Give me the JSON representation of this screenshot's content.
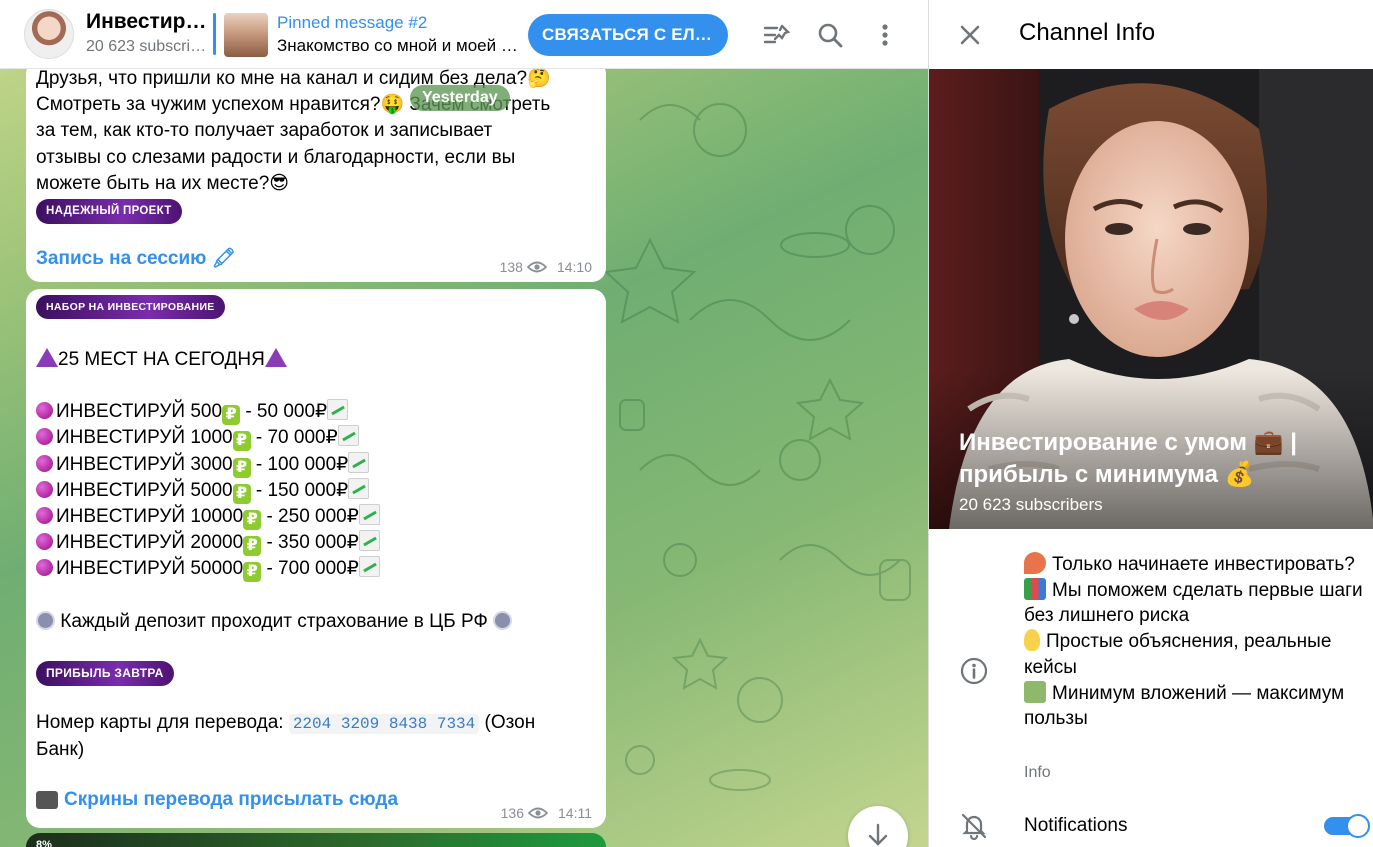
{
  "header": {
    "channel_name": "Инвестирование с умом",
    "subscribers_short": "20 623 subscribers",
    "pinned_title": "Pinned message #2",
    "pinned_text": "Знакомство со мной и моей командой",
    "contact_button": "СВЯЗАТЬСЯ С ЕЛИЗАВЕТОЙ"
  },
  "chat": {
    "date_separator": "Yesterday",
    "message1": {
      "lines": [
        "Друзья, что пришли ко мне на канал и сидим без дела?🤔",
        "Смотреть за чужим успехом нравится?🤑 Зачем смотреть",
        "за тем, как кто-то получает заработок и записывает",
        "отзывы со слезами радости и благодарности, если вы",
        "можете быть на их месте?😎"
      ],
      "badge": "НАДЕЖНЫЙ ПРОЕКТ",
      "link": "Запись на сессию 🖍",
      "views": "138",
      "time": "14:10"
    },
    "message2": {
      "badge_top": "НАБОР НА ИНВЕСТИРОВАНИЕ",
      "headline": "25 МЕСТ НА СЕГОДНЯ",
      "offers": [
        {
          "label": "ИНВЕСТИРУЙ 500",
          "result": " -  50 000₽"
        },
        {
          "label": "ИНВЕСТИРУЙ 1000",
          "result": " - 70 000₽"
        },
        {
          "label": "ИНВЕСТИРУЙ 3000",
          "result": " - 100 000₽"
        },
        {
          "label": "ИНВЕСТИРУЙ 5000",
          "result": " - 150 000₽"
        },
        {
          "label": "ИНВЕСТИРУЙ 10000",
          "result": " - 250 000₽"
        },
        {
          "label": "ИНВЕСТИРУЙ 20000",
          "result": " - 350 000₽"
        },
        {
          "label": "ИНВЕСТИРУЙ 50000",
          "result": " - 700 000₽"
        }
      ],
      "insurance": "Каждый депозит проходит страхование в ЦБ РФ",
      "badge_bottom": "ПРИБЫЛЬ ЗАВТРА",
      "card_prefix": "Номер карты для перевода: ",
      "card_number": "2204 3209 8438 7334",
      "card_bank_1": " (Озон",
      "card_bank_2": "Банк)",
      "link": "Скрины перевода присылать сюда",
      "views": "136",
      "time": "14:11"
    },
    "next_preview": "8%"
  },
  "sidebar": {
    "title": "Channel Info",
    "channel_full_name": "Инвестирование с умом 💼 | прибыль с минимума 💰",
    "subscribers": "20 623 subscribers",
    "info_lines": [
      "Только начинаете инвестировать?",
      "Мы поможем сделать первые шаги без лишнего риска",
      "Простые объяснения, реальные кейсы",
      "Минимум вложений — максимум пользы"
    ],
    "info_label": "Info",
    "notifications_label": "Notifications",
    "notifications_on": true
  },
  "colors": {
    "accent": "#3390ec",
    "badge_purple": "#5a1a87",
    "meta_gray": "#8a8f94"
  }
}
